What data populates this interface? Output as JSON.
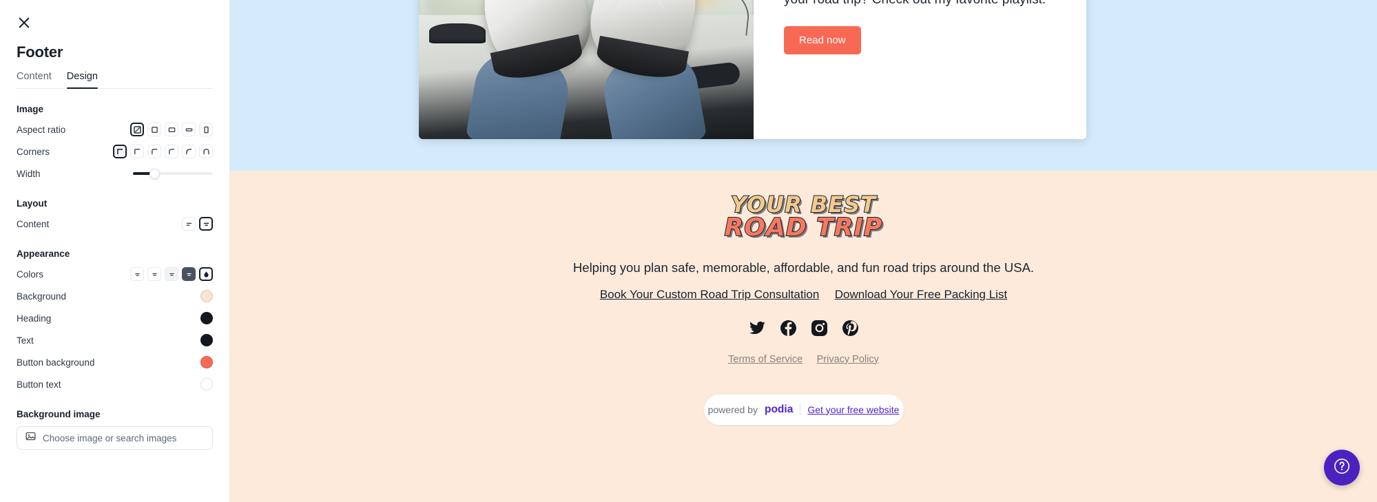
{
  "sidebar": {
    "close_icon": "close-icon",
    "title": "Footer",
    "tabs": [
      {
        "label": "Content",
        "active": false
      },
      {
        "label": "Design",
        "active": true
      }
    ],
    "sections": [
      {
        "title": "Image",
        "rows": [
          {
            "label": "Aspect ratio",
            "type": "icon-group",
            "options": [
              "original-ratio-icon",
              "square-ratio-icon",
              "landscape-4-3-ratio-icon",
              "wide-16-9-ratio-icon",
              "portrait-ratio-icon"
            ],
            "selected_index": 0
          },
          {
            "label": "Corners",
            "type": "icon-group",
            "options": [
              "corner-square-icon",
              "corner-radius-xs-icon",
              "corner-radius-sm-icon",
              "corner-radius-md-icon",
              "corner-radius-lg-icon",
              "corner-radius-full-icon"
            ],
            "selected_index": 0
          },
          {
            "label": "Width",
            "type": "slider",
            "value_percent": 27
          }
        ]
      },
      {
        "title": "Layout",
        "rows": [
          {
            "label": "Content",
            "type": "icon-group",
            "options": [
              "align-left-icon",
              "align-center-icon"
            ],
            "selected_index": 1
          }
        ]
      },
      {
        "title": "Appearance",
        "rows": [
          {
            "label": "Colors",
            "type": "icon-group",
            "options": [
              "color-scheme-1-icon",
              "color-scheme-2-icon",
              "color-scheme-3-icon",
              "color-scheme-4-icon",
              "custom-color-droplet-icon"
            ],
            "selected_index": 4
          },
          {
            "label": "Background",
            "type": "swatch",
            "color": "#fbe4d1"
          },
          {
            "label": "Heading",
            "type": "swatch",
            "color": "#13181f"
          },
          {
            "label": "Text",
            "type": "swatch",
            "color": "#13181f"
          },
          {
            "label": "Button background",
            "type": "swatch",
            "color": "#f86953"
          },
          {
            "label": "Button text",
            "type": "swatch",
            "color": "#ffffff"
          }
        ]
      }
    ],
    "background_image": {
      "title": "Background image",
      "button_label": "Choose image or search images",
      "button_icon": "image-placeholder-icon"
    }
  },
  "canvas": {
    "hero_background_color": "#d4ebfb",
    "promo_card": {
      "image_alt": "feet-in-sneakers-on-car-dashboard-photo",
      "text": "Need some inspiration for what to listen to on your road trip? Check out my favorite playlist.",
      "button_label": "Read now",
      "button_color": "#f86953"
    },
    "footer": {
      "background_color": "#fdeadb",
      "logo": {
        "line1": "YOUR BEST",
        "line2": "ROAD TRIP",
        "line1_color": "#f3c98d",
        "line2_color": "#f8785f"
      },
      "tagline": "Helping you plan safe, memorable, affordable, and fun road trips around the USA.",
      "links": [
        "Book Your Custom Road Trip Consultation",
        "Download Your Free Packing List"
      ],
      "socials": [
        "twitter-icon",
        "facebook-icon",
        "instagram-icon",
        "pinterest-icon"
      ],
      "legal_links": [
        "Terms of Service",
        "Privacy Policy"
      ],
      "podia_badge": {
        "prefix": "powered by",
        "brand": "podia",
        "cta": "Get your free website",
        "brand_color": "#5222d0"
      }
    },
    "help_button": {
      "icon": "question-mark-help-icon",
      "color": "#4b22c0"
    }
  }
}
